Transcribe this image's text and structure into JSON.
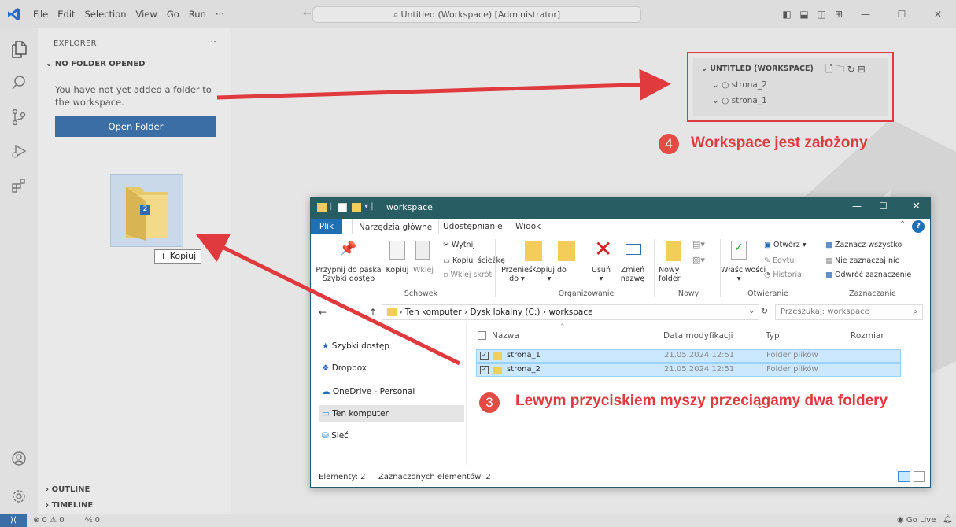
{
  "menu": [
    "File",
    "Edit",
    "Selection",
    "View",
    "Go",
    "Run",
    "···"
  ],
  "command_center": "Untitled (Workspace) [Administrator]",
  "sidebar": {
    "header": "EXPLORER",
    "section": "NO FOLDER OPENED",
    "message": "You have not yet added a folder to the workspace.",
    "open_button": "Open Folder",
    "outline": "OUTLINE",
    "timeline": "TIMELINE"
  },
  "drag": {
    "count": "2",
    "copy_label": "+ Kopiuj"
  },
  "workspace": {
    "title": "UNTITLED (WORKSPACE)",
    "folders": [
      "strona_2",
      "strona_1"
    ]
  },
  "annotations": {
    "step4_num": "4",
    "step4_text": "Workspace jest założony",
    "step3_num": "3",
    "step3_text": "Lewym przyciskiem myszy przeciągamy dwa foldery"
  },
  "explorer": {
    "title": "workspace",
    "tabs": [
      "Plik",
      "Narzędzia główne",
      "Udostępnianie",
      "Widok"
    ],
    "ribbon": {
      "pin": "Przypnij do paska Szybki dostęp",
      "copy": "Kopiuj",
      "paste": "Wklej",
      "cut": "Wytnij",
      "copy_path": "Kopiuj ścieżkę",
      "paste_shortcut": "Wklej skrót",
      "group_clipboard": "Schowek",
      "move_to": "Przenieś do ▾",
      "copy_to": "Kopiuj do ▾",
      "delete": "Usuń ▾",
      "rename": "Zmień nazwę",
      "group_organize": "Organizowanie",
      "new_folder": "Nowy folder",
      "group_new": "Nowy",
      "properties": "Właściwości ▾",
      "open": "Otwórz ▾",
      "edit": "Edytuj",
      "history": "Historia",
      "group_open": "Otwieranie",
      "select_all": "Zaznacz wszystko",
      "select_none": "Nie zaznaczaj nic",
      "invert": "Odwróć zaznaczenie",
      "group_select": "Zaznaczanie"
    },
    "address": [
      "Ten komputer",
      "Dysk lokalny (C:)",
      "workspace"
    ],
    "search_placeholder": "Przeszukaj: workspace",
    "nav": [
      "Szybki dostęp",
      "Dropbox",
      "OneDrive - Personal",
      "Ten komputer",
      "Sieć"
    ],
    "columns": [
      "Nazwa",
      "Data modyfikacji",
      "Typ",
      "Rozmiar"
    ],
    "rows": [
      {
        "name": "strona_1",
        "date": "21.05.2024 12:51",
        "type": "Folder plików"
      },
      {
        "name": "strona_2",
        "date": "21.05.2024 12:51",
        "type": "Folder plików"
      }
    ],
    "status_items": "Elementy: 2",
    "status_selected": "Zaznaczonych elementów: 2"
  },
  "statusbar": {
    "problems": "⊗ 0 ⚠ 0",
    "ports": "⅍ 0",
    "golive": "Go Live"
  },
  "colors": {
    "accent_red": "#e0393e",
    "vs_blue": "#3b6ea5",
    "fe_titlebar": "#275d63"
  }
}
